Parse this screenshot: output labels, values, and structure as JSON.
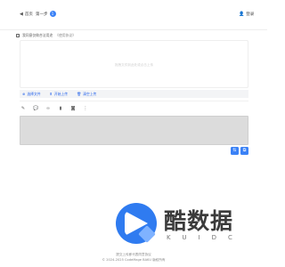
{
  "nav": {
    "home_label": "首页",
    "step_label": "第一步",
    "step_badge": "1",
    "login_label": "登录"
  },
  "notice": {
    "text": "我同意仅做合法用途",
    "link_text": "《使用协议》"
  },
  "upload": {
    "hint": "拖拽文件到此处或点击上传"
  },
  "buttons": {
    "select_file": "选择文件",
    "upload": "开始上传",
    "clear": "清空上传"
  },
  "toolbar_icons": [
    "edit-icon",
    "comment-icon",
    "link-icon",
    "delete-icon",
    "image-icon",
    "more-icon"
  ],
  "watermark": {
    "brand": "酷数据",
    "sub": "KUIDC"
  },
  "footer": {
    "line1": "提交上传即代表同意协议",
    "line2": "© 2024-2025 CodeMage BAKU 版权所有"
  },
  "colors": {
    "accent": "#3b82f6",
    "link": "#2563eb"
  }
}
